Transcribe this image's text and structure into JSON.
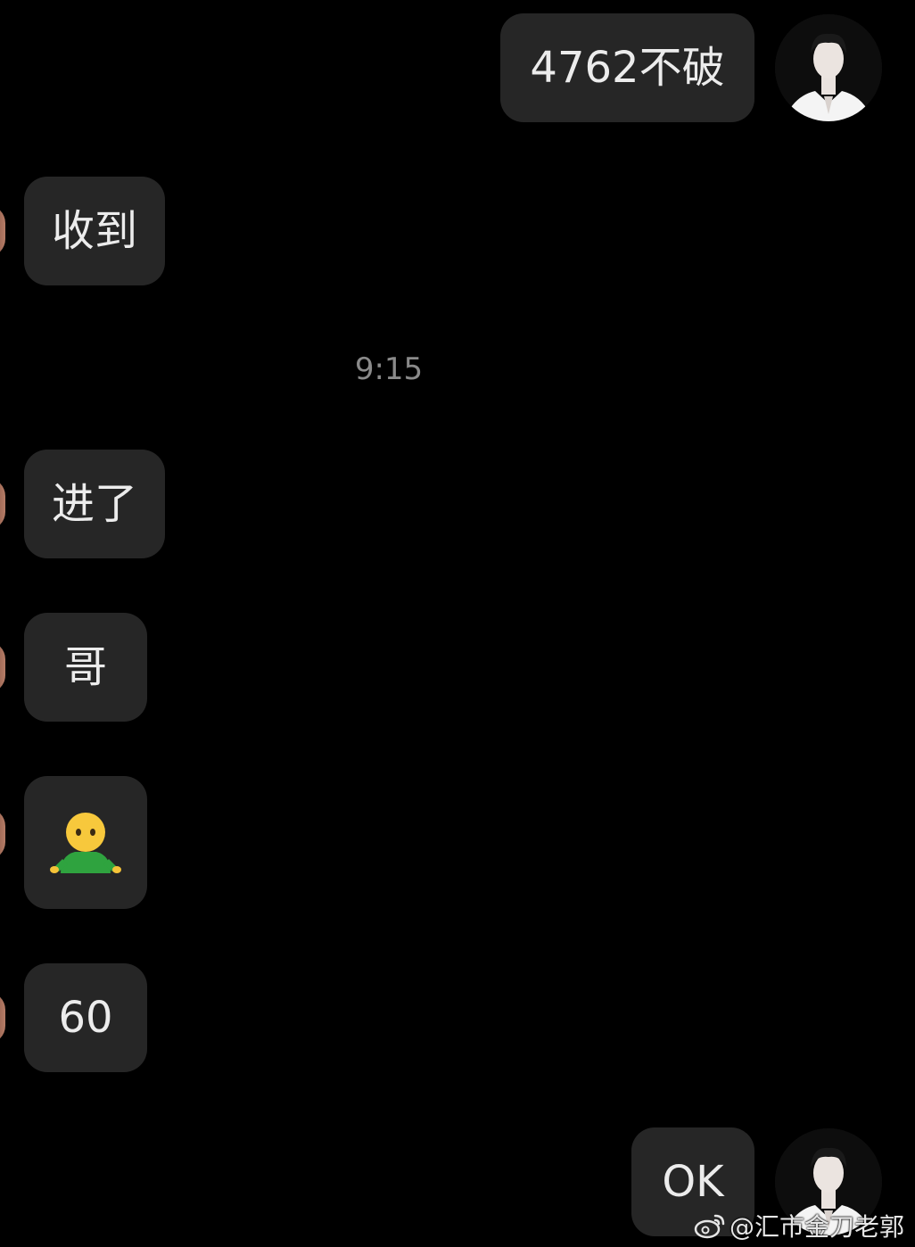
{
  "messages": [
    {
      "side": "right",
      "text": "4762不破"
    },
    {
      "side": "left",
      "text": "收到"
    },
    {
      "side": "left",
      "text": "进了"
    },
    {
      "side": "left",
      "text": "哥"
    },
    {
      "side": "left",
      "emoji": "person-shrugging-emoji"
    },
    {
      "side": "left",
      "text": "60"
    },
    {
      "side": "right",
      "text": "OK"
    }
  ],
  "timestamp": "9:15",
  "watermark": {
    "text": "@汇市金刀老郭",
    "icon": "weibo-logo-icon"
  },
  "colors": {
    "background": "#000000",
    "bubble": "#262626",
    "text": "#ececec",
    "timestamp": "#8a8a8a"
  }
}
